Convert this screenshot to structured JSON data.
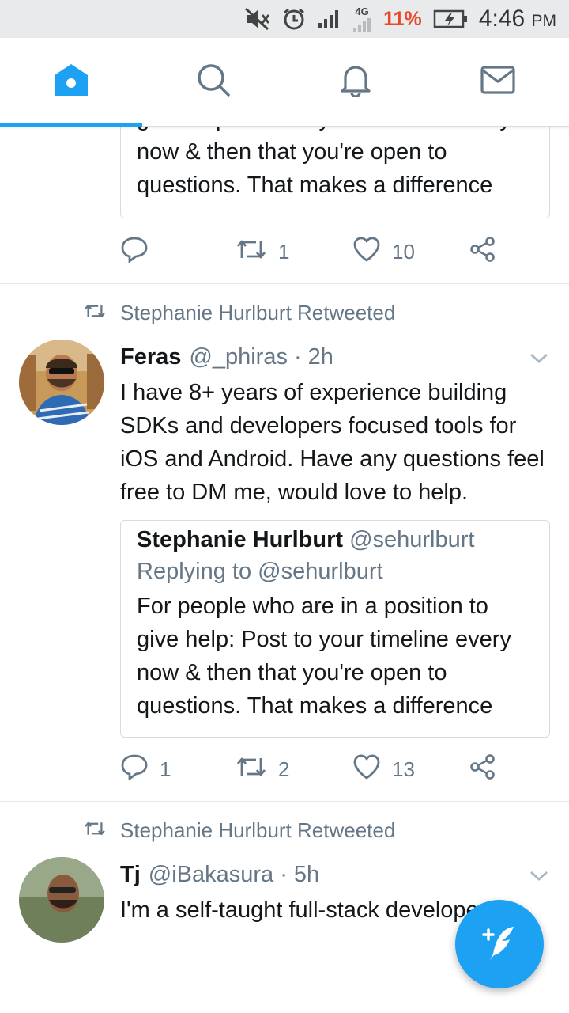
{
  "status_bar": {
    "network": "4G",
    "battery_percent": "11%",
    "time": "4:46",
    "ampm": "PM"
  },
  "nav": {
    "tabs": [
      {
        "icon": "home-icon",
        "active": true
      },
      {
        "icon": "search-icon",
        "active": false
      },
      {
        "icon": "bell-icon",
        "active": false
      },
      {
        "icon": "mail-icon",
        "active": false
      }
    ],
    "accent": "#1da1f2"
  },
  "tweet0": {
    "quote_text": "give help: Post to your timeline every now & then that you're open to questions. That makes a difference",
    "retweet_count": "1",
    "like_count": "10"
  },
  "tweet1": {
    "retweeted_by": "Stephanie Hurlburt Retweeted",
    "name": "Feras",
    "handle": "@_phiras",
    "time": "· 2h",
    "text": "I have 8+ years of experience building SDKs and developers focused tools for iOS and Android. Have any questions feel free to DM me, would love to help.",
    "quote": {
      "name": "Stephanie Hurlburt",
      "handle": "@sehurlburt",
      "replying": "Replying to @sehurlburt",
      "text": "For people who are in a position to give help: Post to your timeline every now & then that you're open to questions. That makes a difference"
    },
    "reply_count": "1",
    "retweet_count": "2",
    "like_count": "13"
  },
  "tweet2": {
    "retweeted_by": "Stephanie Hurlburt Retweeted",
    "name": "Tj",
    "handle": "@iBakasura",
    "time": "· 5h",
    "text": "I'm a self-taught full-stack developer"
  }
}
